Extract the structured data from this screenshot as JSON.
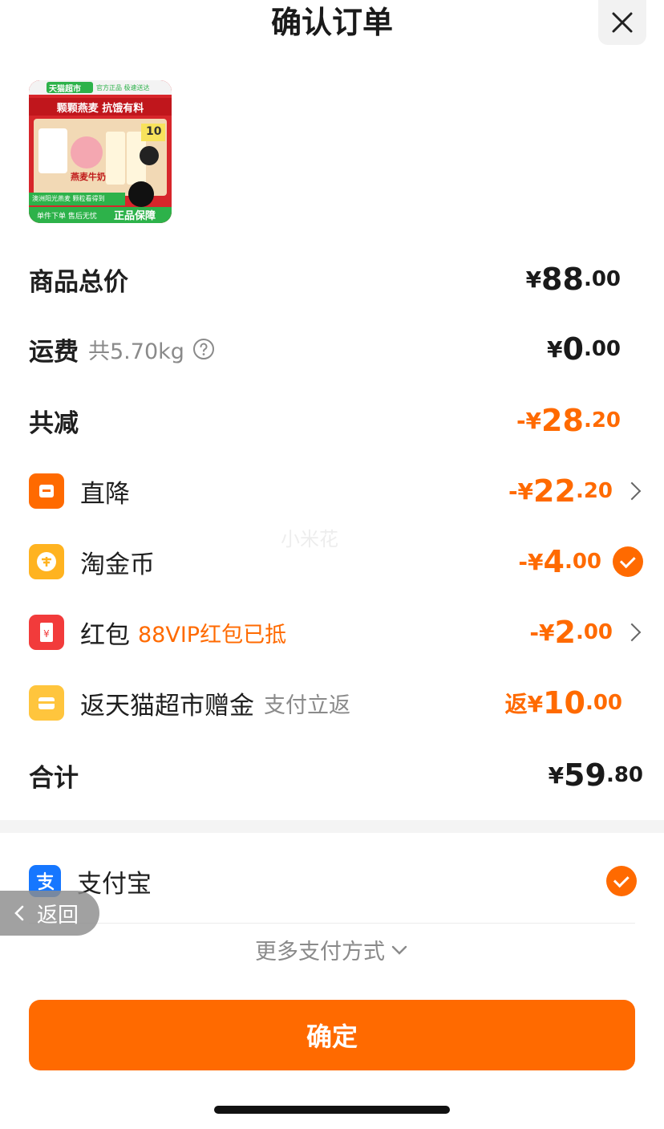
{
  "header": {
    "title": "确认订单",
    "close_icon": "close-icon"
  },
  "product": {
    "badge": "天猫超市",
    "badge_sub": "官方正品 极速送达",
    "headline": "颗颗燕麦 抗饿有料",
    "box_text": "燕麦牛奶",
    "price_tag": "10",
    "footer1": "澳洲阳光燕麦 颗粒看得到",
    "footer2": "单件下单 售后无忧",
    "guarantee": "正品保障"
  },
  "rows": {
    "total_price": {
      "label": "商品总价",
      "currency": "¥",
      "int": "88",
      "dec": ".00"
    },
    "shipping": {
      "label": "运费",
      "sub": "共5.70kg",
      "currency": "¥",
      "int": "0",
      "dec": ".00"
    },
    "discount_total": {
      "label": "共减",
      "currency": "-¥",
      "int": "28",
      "dec": ".20"
    },
    "direct_cut": {
      "label": "直降",
      "currency": "-¥",
      "int": "22",
      "dec": ".20"
    },
    "coins": {
      "label": "淘金币",
      "currency": "-¥",
      "int": "4",
      "dec": ".00"
    },
    "red_packet": {
      "label": "红包",
      "sub": "88VIP红包已抵",
      "currency": "-¥",
      "int": "2",
      "dec": ".00"
    },
    "cashback": {
      "label": "返天猫超市赠金",
      "sub": "支付立返",
      "currency": "返¥",
      "int": "10",
      "dec": ".00"
    },
    "sum": {
      "label": "合计",
      "currency": "¥",
      "int": "59",
      "dec": ".80"
    }
  },
  "payment": {
    "method": "支付宝",
    "more": "更多支付方式"
  },
  "back_label": "返回",
  "watermark": "小米花",
  "confirm_label": "确定",
  "colors": {
    "accent": "#ff6a00",
    "alipay": "#1677ff",
    "tmall_green": "#2db24a"
  }
}
